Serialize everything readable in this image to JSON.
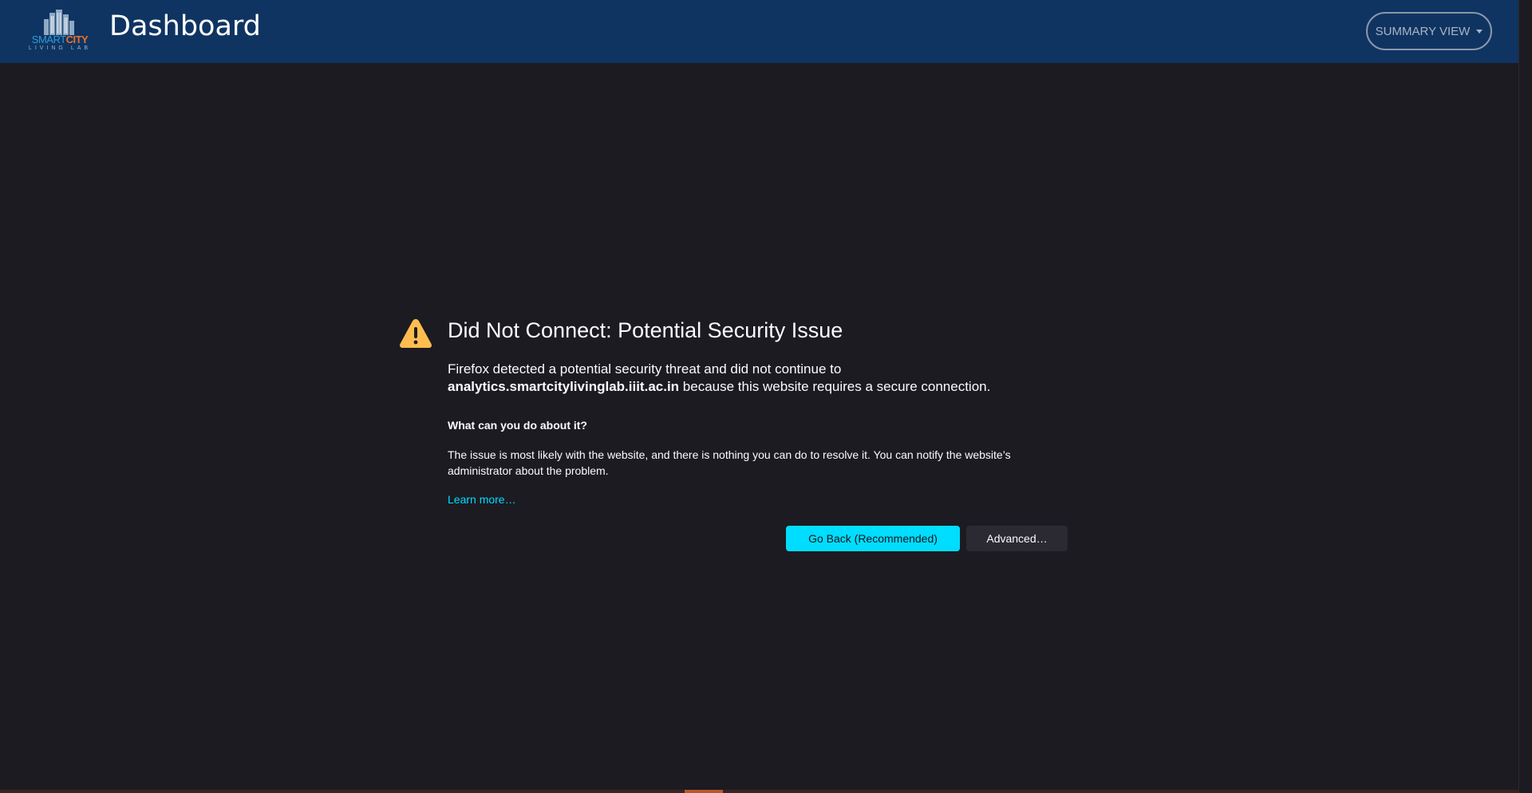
{
  "header": {
    "title": "Dashboard",
    "logo": {
      "line1_part1": "SMART",
      "line1_part2": "CITY",
      "line2": "LIVING LAB",
      "icon": "city-skyline-icon"
    },
    "view_button": {
      "label": "SUMMARY VIEW",
      "icon": "caret-down-icon"
    }
  },
  "colors": {
    "header_bg": "#0f3462",
    "page_bg": "#1c1b22",
    "warning": "#ffbd4f",
    "link": "#00ddff",
    "primary_button": "#00ddff"
  },
  "error": {
    "icon": "warning-icon",
    "title": "Did Not Connect: Potential Security Issue",
    "intro_line1": "Firefox detected a potential security threat and did not continue to",
    "host": "analytics.smartcitylivinglab.iiit.ac.in",
    "intro_line2_rest": " because this website requires a secure connection.",
    "question": "What can you do about it?",
    "detail": "The issue is most likely with the website, and there is nothing you can do to resolve it. You can notify the website’s administrator about the problem.",
    "learn_more": "Learn more…",
    "go_back_label": "Go Back (Recommended)",
    "advanced_label": "Advanced…"
  }
}
